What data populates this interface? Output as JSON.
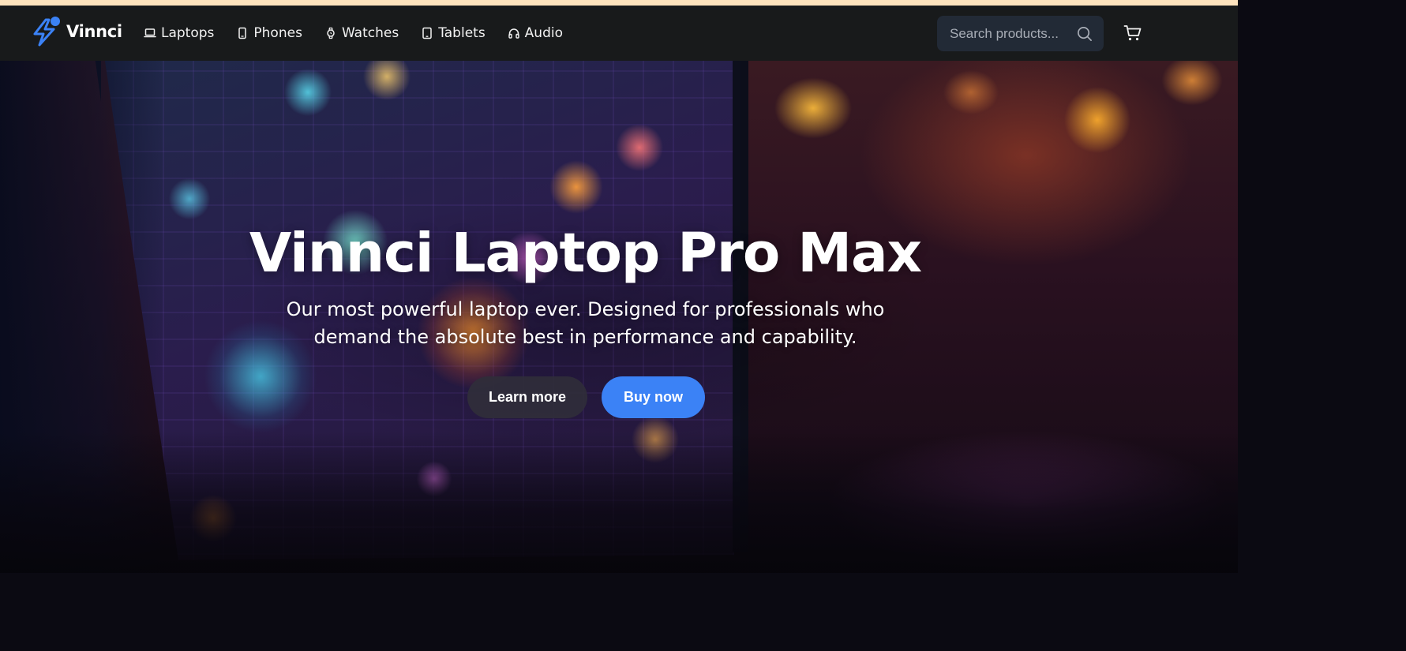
{
  "brand": {
    "name": "Vinnci",
    "accent": "#3b82f6"
  },
  "nav": {
    "items": [
      {
        "label": "Laptops",
        "icon": "laptop-icon"
      },
      {
        "label": "Phones",
        "icon": "phone-icon"
      },
      {
        "label": "Watches",
        "icon": "watch-icon"
      },
      {
        "label": "Tablets",
        "icon": "tablet-icon"
      },
      {
        "label": "Audio",
        "icon": "headphones-icon"
      }
    ]
  },
  "search": {
    "placeholder": "Search products...",
    "value": "",
    "icon": "search-icon"
  },
  "cart": {
    "icon": "cart-icon"
  },
  "hero": {
    "title": "Vinnci Laptop Pro Max",
    "subtitle": "Our most powerful laptop ever. Designed for professionals who demand the absolute best in performance and capability.",
    "secondary_button": "Learn more",
    "primary_button": "Buy now"
  },
  "colors": {
    "top_strip": "#fde3bd",
    "navbar_bg": "#181a1b",
    "search_bg": "#222a36",
    "primary_button": "#3b82f6"
  }
}
